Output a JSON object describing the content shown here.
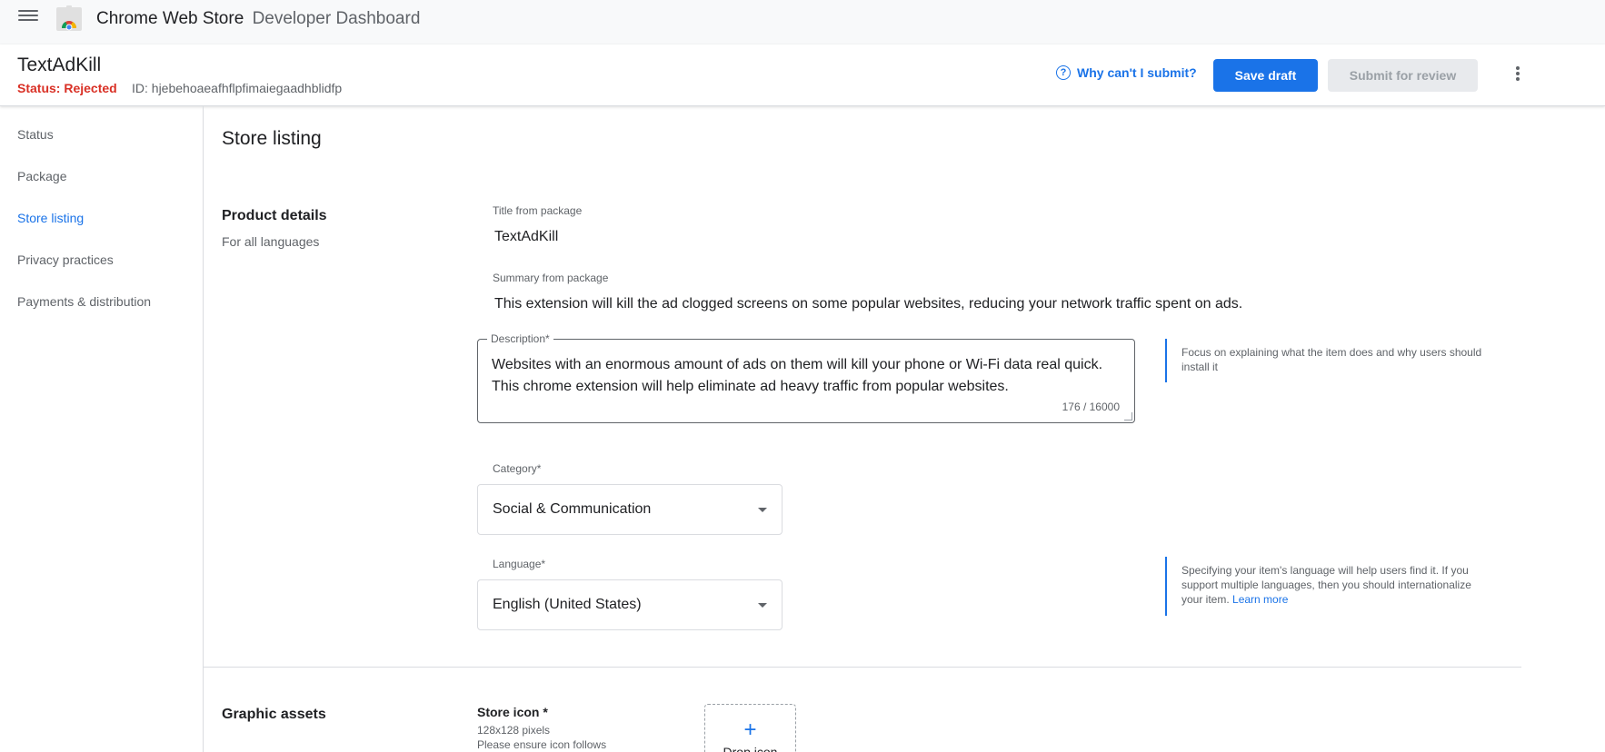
{
  "app": {
    "title": "Chrome Web Store",
    "subtitle": "Developer Dashboard",
    "menu_icon": "hamburger-menu-icon",
    "logo_icon": "chrome-web-store-logo"
  },
  "item": {
    "name": "TextAdKill",
    "status": "Status: Rejected",
    "id": "ID: hjebehoaeafhflpfimaiegaadhblidfp"
  },
  "toolbar": {
    "why_label": "Why can't I submit?",
    "save_label": "Save draft",
    "submit_label": "Submit for review",
    "more_icon": "more-vert-icon"
  },
  "sidebar": {
    "items": [
      {
        "label": "Status",
        "active": false
      },
      {
        "label": "Package",
        "active": false
      },
      {
        "label": "Store listing",
        "active": true
      },
      {
        "label": "Privacy practices",
        "active": false
      },
      {
        "label": "Payments & distribution",
        "active": false
      }
    ]
  },
  "main": {
    "page_title": "Store listing",
    "product_details": {
      "title": "Product details",
      "subtitle": "For all languages",
      "title_label": "Title from package",
      "title_value": "TextAdKill",
      "summary_label": "Summary from package",
      "summary_value": "This extension will kill the ad clogged screens on some popular websites, reducing your network traffic spent on ads.",
      "description_label": "Description*",
      "description_value": "Websites with an enormous amount of ads on them will kill your phone or Wi-Fi data real quick. This chrome extension will help eliminate ad heavy traffic from popular websites.",
      "description_count": "176 / 16000",
      "description_help": "Focus on explaining what the item does and why users should install it",
      "category_label": "Category*",
      "category_value": "Social & Communication",
      "language_label": "Language*",
      "language_value": "English (United States)",
      "language_help": "Specifying your item's language will help users find it. If you support multiple languages, then you should internationalize your item.",
      "language_help_link": "Learn more"
    },
    "graphic_assets": {
      "title": "Graphic assets",
      "store_icon_title": "Store icon *",
      "store_icon_size": "128x128 pixels",
      "store_icon_note": "Please ensure icon follows",
      "drop_plus": "+",
      "drop_label": "Drop icon"
    }
  },
  "colors": {
    "accent": "#1a73e8",
    "rejected": "#d93025",
    "disabled_bg": "#e8eaed",
    "topbar_bg": "#f8f9fa"
  }
}
